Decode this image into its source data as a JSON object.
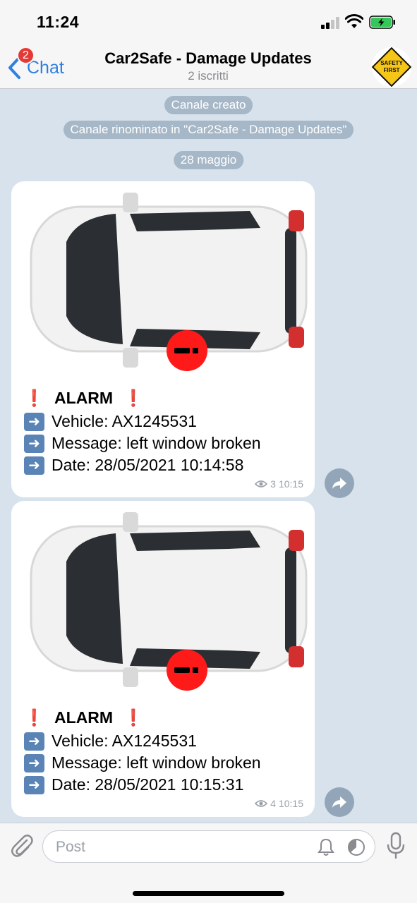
{
  "status_bar": {
    "time": "11:24"
  },
  "header": {
    "back_label": "Chat",
    "unread_badge": "2",
    "title": "Car2Safe - Damage Updates",
    "subtitle": "2 iscritti",
    "avatar_text": "SAFETY FIRST",
    "accent_color": "#2f7fe0"
  },
  "service_messages": [
    "Canale creato",
    "Canale rinominato in \"Car2Safe - Damage Updates\"",
    "28 maggio"
  ],
  "messages": [
    {
      "heading": "ALARM",
      "vehicle": "Vehicle: AX1245531",
      "message": "Message: left window broken",
      "date": "Date: 28/05/2021 10:14:58",
      "views": "3",
      "time": "10:15"
    },
    {
      "heading": "ALARM",
      "vehicle": "Vehicle: AX1245531",
      "message": "Message: left window broken",
      "date": "Date: 28/05/2021 10:15:31",
      "views": "4",
      "time": "10:15"
    }
  ],
  "composer": {
    "placeholder": "Post"
  },
  "icons": [
    "signal-icon",
    "wifi-icon",
    "battery-icon",
    "back-chevron-icon",
    "eye-icon",
    "share-icon",
    "paperclip-icon",
    "bell-icon",
    "timer-icon",
    "microphone-icon",
    "exclamation-icon",
    "right-arrow-icon"
  ]
}
